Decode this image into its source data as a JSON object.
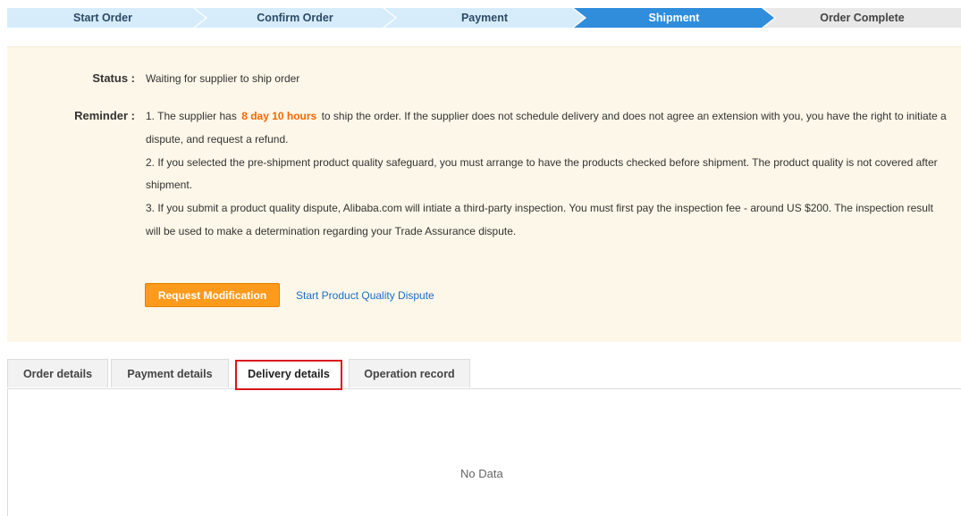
{
  "progress": {
    "steps": [
      "Start Order",
      "Confirm Order",
      "Payment",
      "Shipment",
      "Order Complete"
    ],
    "active_step": "Shipment",
    "colors": {
      "done": "#d6ecfb",
      "active": "#2f8ddb",
      "pending": "#e8e8e8"
    }
  },
  "status": {
    "label": "Status :",
    "value": "Waiting for supplier to ship order"
  },
  "reminder": {
    "label": "Reminder :",
    "item1_pre": "1. The supplier has ",
    "item1_highlight": "8 day 10 hours",
    "item1_post": " to ship the order. If the supplier does not schedule delivery and does not agree an extension with you, you have the right to initiate a dispute, and request a refund.",
    "item2": "2. If you selected the pre-shipment product quality safeguard, you must arrange to have the products checked before shipment. The product quality is not covered after shipment.",
    "item3": "3. If you submit a product quality dispute, Alibaba.com will intiate a third-party inspection. You must first pay the inspection fee - around US $200. The inspection result will be used to make a determination regarding your Trade Assurance dispute."
  },
  "actions": {
    "request_modification": "Request Modification",
    "start_dispute": "Start Product Quality Dispute"
  },
  "tabs": [
    "Order details",
    "Payment details",
    "Delivery details",
    "Operation record"
  ],
  "active_tab": "Delivery details",
  "content": {
    "empty_text": "No Data"
  }
}
